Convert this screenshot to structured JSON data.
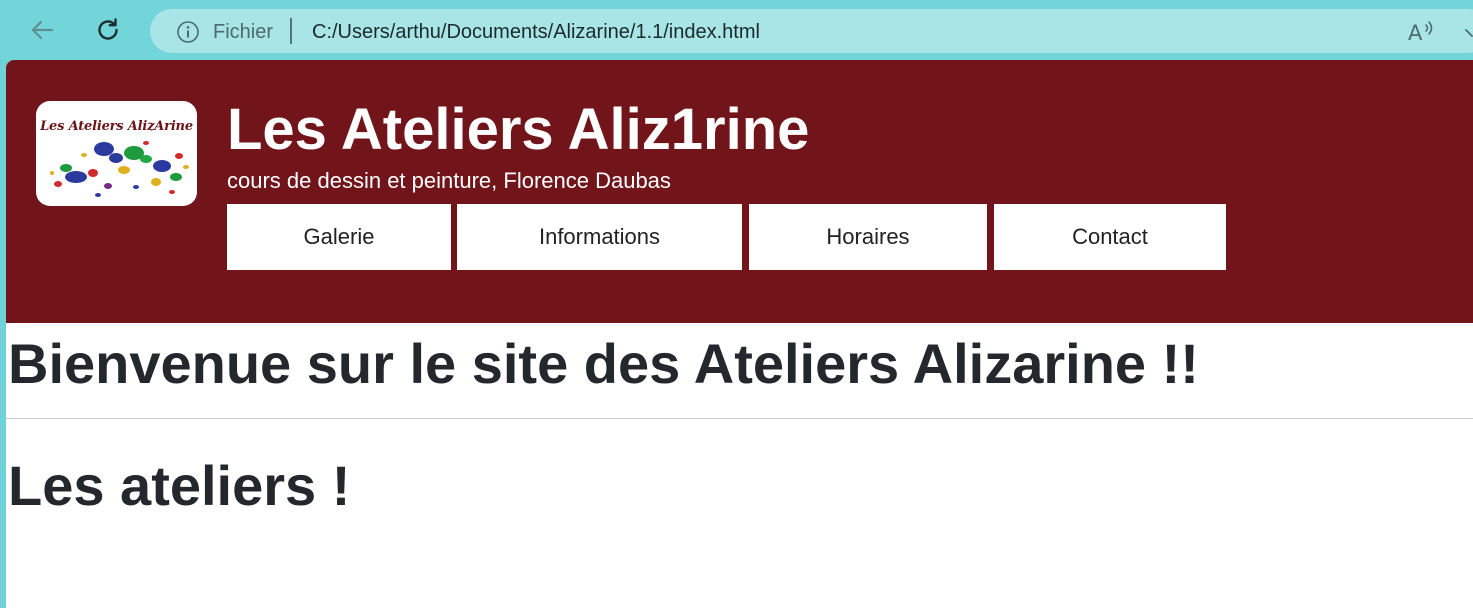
{
  "browser": {
    "address_scheme": "Fichier",
    "address_url": "C:/Users/arthu/Documents/Alizarine/1.1/index.html"
  },
  "site": {
    "logo_text": "Les Ateliers AlizArine",
    "title": "Les Ateliers Aliz1rine",
    "subtitle": "cours de dessin et peinture, Florence Daubas",
    "nav": [
      "Galerie",
      "Informations",
      "Horaires",
      "Contact"
    ]
  },
  "content": {
    "welcome_heading": "Bienvenue sur le site des Ateliers Alizarine !!",
    "ateliers_heading": "Les ateliers !"
  },
  "colors": {
    "header_bg": "#72151b",
    "toolbar_bg": "#72d5da",
    "address_bg": "#a9e5e7"
  },
  "icons": [
    "back-arrow-icon",
    "reload-icon",
    "info-icon",
    "read-aloud-icon",
    "chevron-right-icon"
  ]
}
